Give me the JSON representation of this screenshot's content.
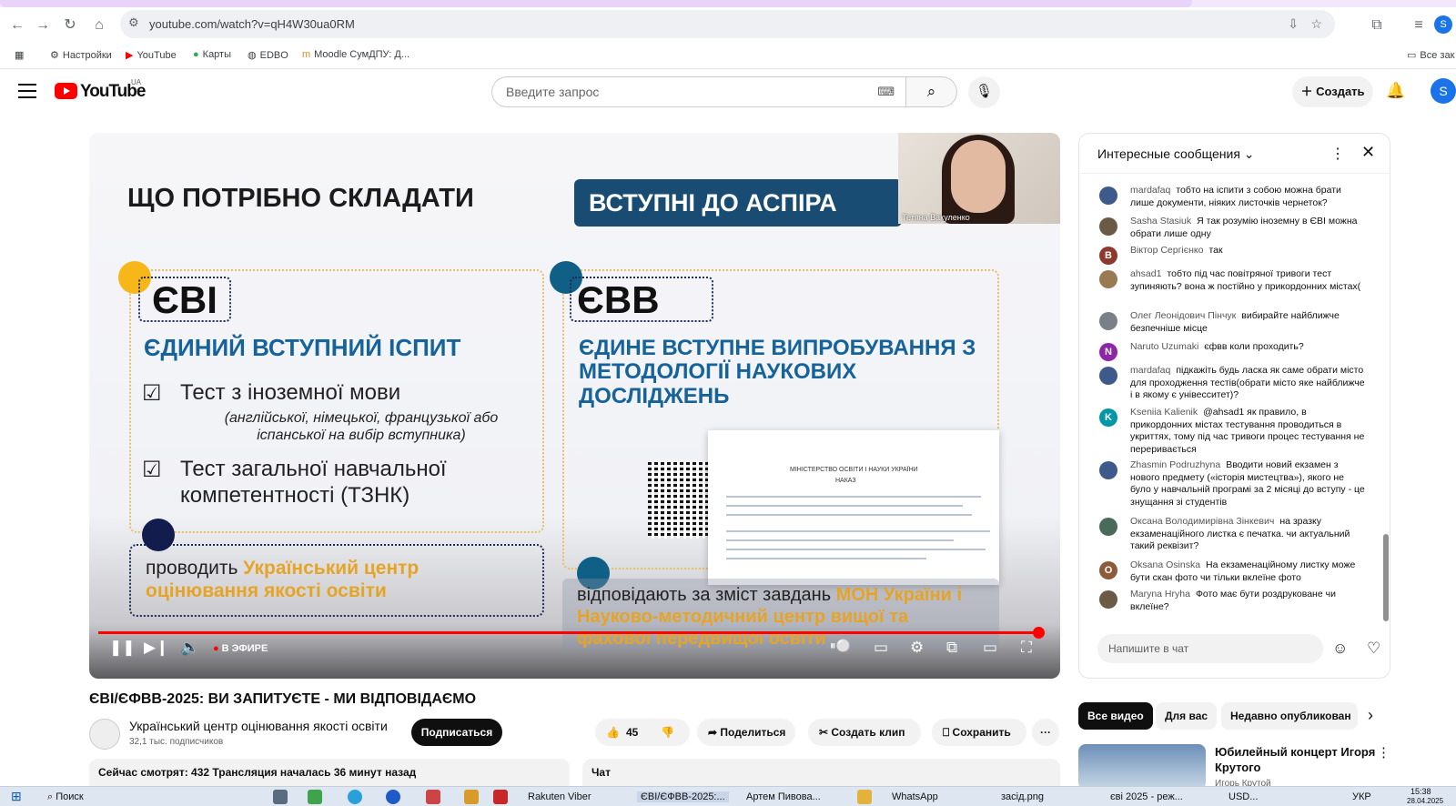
{
  "browser": {
    "url": "youtube.com/watch?v=qH4W30ua0RM",
    "bookmarks": [
      "Настройки",
      "YouTube",
      "Карты",
      "EDBO",
      "Moodle СумДПУ: Д...",
      "Все зак"
    ],
    "profile_initial": "S"
  },
  "yt_header": {
    "logo_text": "YouTube",
    "country": "UA",
    "search_placeholder": "Введите запрос",
    "create_label": "Создать",
    "avatar_initial": "S"
  },
  "slide": {
    "heading": "ЩО ПОТРІБНО СКЛАДАТИ",
    "banner": "ВСТУПНІ ДО АСПІРА",
    "cam_name": "Тетяна Вакуленко",
    "left_badge": "ЄВІ",
    "left_title": "ЄДИНИЙ ВСТУПНИЙ ІСПИТ",
    "left_item1": "Тест з іноземної  мови",
    "left_item1_note": "(англійської, німецької, французької або іспанської на вибір вступника)",
    "left_item2": "Тест загальної навчальної компетентності (ТЗНК)",
    "left_bottom_prefix": "проводить ",
    "left_bottom_highlight": "Український центр оцінювання якості освіти",
    "right_badge": "ЄВВ",
    "right_title": "ЄДИНЕ ВСТУПНЕ ВИПРОБУВАННЯ З МЕТОДОЛОГІЇ НАУКОВИХ ДОСЛІДЖЕНЬ",
    "doc_header": "МІНІСТЕРСТВО ОСВІТИ І НАУКИ УКРАЇНИ",
    "doc_title": "НАКАЗ",
    "right_bottom_prefix": "відповідають за зміст завдань ",
    "right_bottom_highlight": "МОН України і Науково-методичний центр вищої та фахової передвищої освіти"
  },
  "player": {
    "live_label": "В ЭФИРЕ"
  },
  "video": {
    "title": "ЄВІ/ЄФВВ-2025: ВИ ЗАПИТУЄТЕ - МИ ВІДПОВІДАЄМО",
    "channel": "Український центр оцінювання якості освіти",
    "subscribers": "32,1 тыс. подписчиков",
    "subscribe_label": "Подписаться",
    "likes": "45",
    "share_label": "Поделиться",
    "clip_label": "Создать клип",
    "save_label": "Сохранить",
    "watching": "Сейчас смотрят: 432  Трансляция началась 36 минут назад",
    "chat_tab": "Чат"
  },
  "chat": {
    "header": "Интересные сообщения",
    "input_placeholder": "Напишите в чат",
    "messages": [
      {
        "author": "mardafaq",
        "text": "тобто на іспити з собою можна брати лише документи, ніяких листочків чернеток?",
        "avatar": "",
        "color": "#3e5a8a"
      },
      {
        "author": "Sasha Stasiuk",
        "text": "Я так розумію іноземну в ЄВІ можна обрати лише одну",
        "avatar": "",
        "color": "#6b5a46"
      },
      {
        "author": "Віктор Сергієнко",
        "text": "так",
        "avatar": "В",
        "color": "#8d3a2e"
      },
      {
        "author": "ahsad1",
        "text": "тобто під час повітряної тривоги тест зупиняють? вона ж постійно у прикордонних містах(",
        "avatar": "",
        "color": "#9a7a55"
      },
      {
        "author": "Олег Леонідович Пінчук",
        "text": "вибирайте найближче безпечніше місце",
        "avatar": "",
        "color": "#7a8088"
      },
      {
        "author": "Naruto Uzumaki",
        "text": "єфвв коли проходить?",
        "avatar": "N",
        "color": "#8e24aa"
      },
      {
        "author": "mardafaq",
        "text": "підкажіть будь ласка як саме обрати місто для проходження тестів(обрати місто яке найближче і в якому є унівесситет)?",
        "avatar": "",
        "color": "#3e5a8a"
      },
      {
        "author": "Kseniia Kalienik",
        "text": "@ahsad1 як правило, в прикордонних містах тестування проводиться в укриттях, тому під час тривоги процес тестування не переривається",
        "avatar": "K",
        "color": "#0097a7"
      },
      {
        "author": "Zhasmin Podruzhyna",
        "text": "Вводити новий екзамен з нового предмету («історія мистецтва»), якого не було у навчальній програмі за 2 місяці до вступу - це знущання зі студентів",
        "avatar": "",
        "color": "#3e5a8a"
      },
      {
        "author": "Оксана Володимирівна Зінкевич",
        "text": "на зразку екзаменаційного листка є печатка. чи актуальний такий реквізит?",
        "avatar": "",
        "color": "#4a6a5a"
      },
      {
        "author": "Oksana Osinska",
        "text": "На екзаменаційному листку може бути скан фото чи тільки вклеїне фото",
        "avatar": "O",
        "color": "#8d5a3a"
      },
      {
        "author": "Maryna Hryha",
        "text": "Фото має бути роздруковане чи вклеїне?",
        "avatar": "",
        "color": "#6b5a46"
      }
    ]
  },
  "recs": {
    "chips": [
      "Все видео",
      "Для вас",
      "Недавно опубликован"
    ],
    "title": "Юбилейный концерт Игоря Крутого",
    "author": "Игорь Крутой"
  },
  "taskbar": {
    "search": "Поиск",
    "apps": [
      "Rakuten Viber",
      "ЄВІ/ЄФВВ-2025:...",
      "Артем Пивова...",
      "WhatsApp",
      "засід.png",
      "єві 2025 - реж...",
      "USD..."
    ],
    "lang": "УКР",
    "time": "15:38",
    "date": "28.04.2025"
  }
}
